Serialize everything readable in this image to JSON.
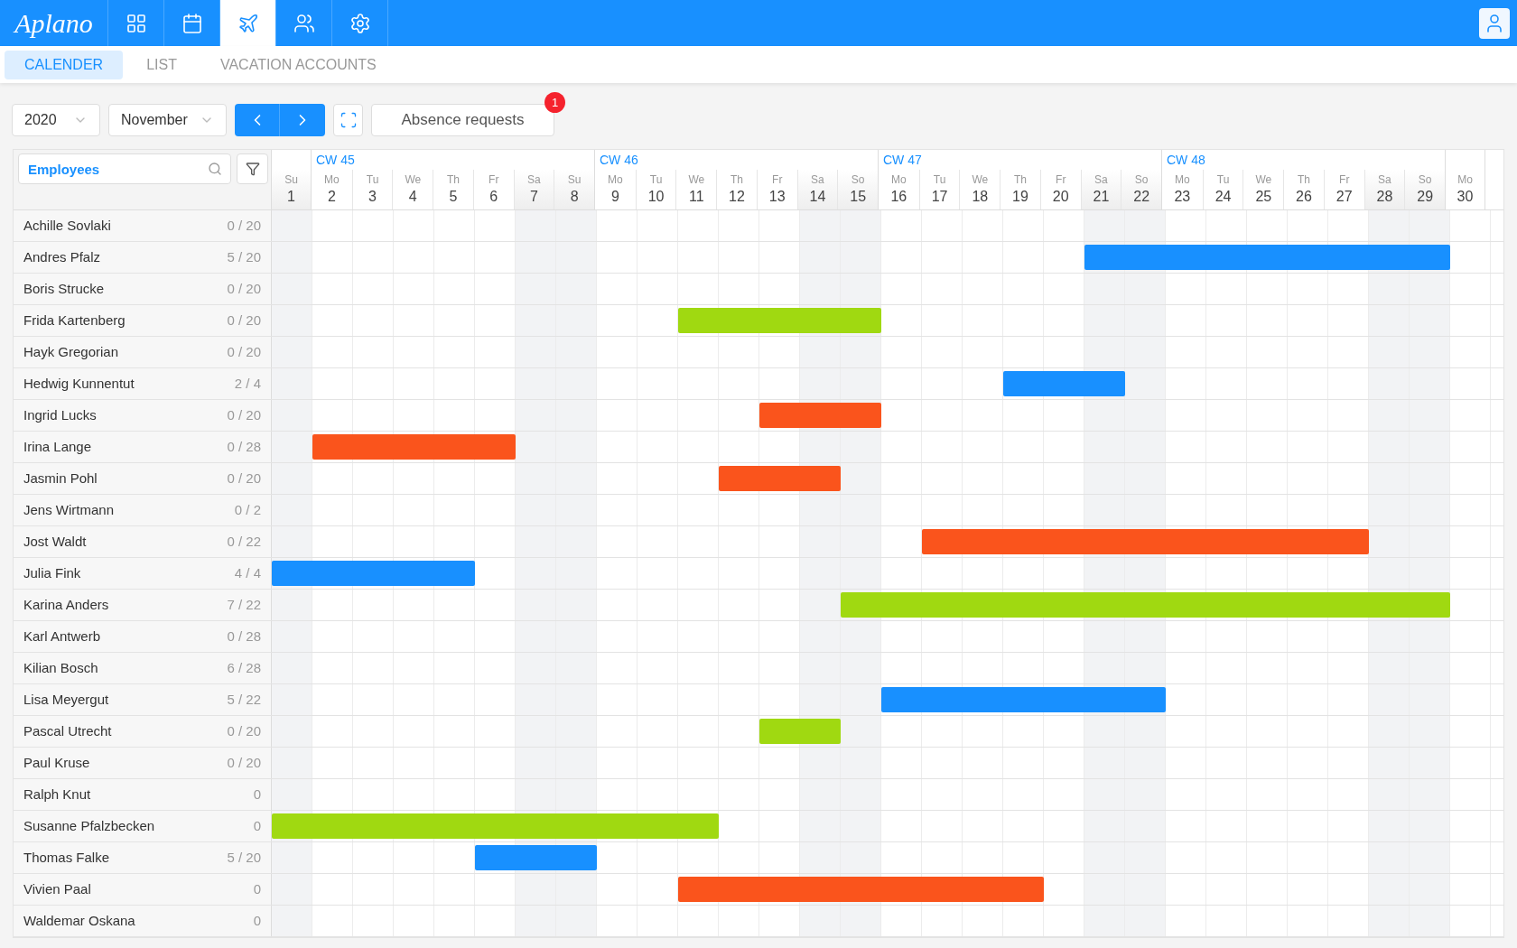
{
  "app": {
    "logo": "Aplano"
  },
  "nav": [
    {
      "kind": "dashboard",
      "selected": false
    },
    {
      "kind": "calendar",
      "selected": false
    },
    {
      "kind": "plane",
      "selected": true
    },
    {
      "kind": "users",
      "selected": false
    },
    {
      "kind": "settings",
      "selected": false
    }
  ],
  "subtabs": [
    {
      "label": "CALENDER",
      "selected": true
    },
    {
      "label": "LIST",
      "selected": false
    },
    {
      "label": "VACATION ACCOUNTS",
      "selected": false
    }
  ],
  "toolbar": {
    "year": "2020",
    "month": "November",
    "absence_requests": {
      "label": "Absence requests",
      "badge": "1"
    }
  },
  "employee_search": {
    "placeholder": "Employees"
  },
  "weeks": [
    {
      "days": [
        {
          "weekday": "Su",
          "day": "1",
          "weekend": true
        }
      ]
    },
    {
      "label": "CW 45",
      "days": [
        {
          "weekday": "Mo",
          "day": "2",
          "weekend": false
        },
        {
          "weekday": "Tu",
          "day": "3",
          "weekend": false
        },
        {
          "weekday": "We",
          "day": "4",
          "weekend": false
        },
        {
          "weekday": "Th",
          "day": "5",
          "weekend": false
        },
        {
          "weekday": "Fr",
          "day": "6",
          "weekend": false
        },
        {
          "weekday": "Sa",
          "day": "7",
          "weekend": true
        },
        {
          "weekday": "Su",
          "day": "8",
          "weekend": true
        }
      ]
    },
    {
      "label": "CW 46",
      "days": [
        {
          "weekday": "Mo",
          "day": "9",
          "weekend": false
        },
        {
          "weekday": "Tu",
          "day": "10",
          "weekend": false
        },
        {
          "weekday": "We",
          "day": "11",
          "weekend": false
        },
        {
          "weekday": "Th",
          "day": "12",
          "weekend": false
        },
        {
          "weekday": "Fr",
          "day": "13",
          "weekend": false
        },
        {
          "weekday": "Sa",
          "day": "14",
          "weekend": true
        },
        {
          "weekday": "So",
          "day": "15",
          "weekend": true
        }
      ]
    },
    {
      "label": "CW 47",
      "days": [
        {
          "weekday": "Mo",
          "day": "16",
          "weekend": false
        },
        {
          "weekday": "Tu",
          "day": "17",
          "weekend": false
        },
        {
          "weekday": "We",
          "day": "18",
          "weekend": false
        },
        {
          "weekday": "Th",
          "day": "19",
          "weekend": false
        },
        {
          "weekday": "Fr",
          "day": "20",
          "weekend": false
        },
        {
          "weekday": "Sa",
          "day": "21",
          "weekend": true
        },
        {
          "weekday": "So",
          "day": "22",
          "weekend": true
        }
      ]
    },
    {
      "label": "CW 48",
      "days": [
        {
          "weekday": "Mo",
          "day": "23",
          "weekend": false
        },
        {
          "weekday": "Tu",
          "day": "24",
          "weekend": false
        },
        {
          "weekday": "We",
          "day": "25",
          "weekend": false
        },
        {
          "weekday": "Th",
          "day": "26",
          "weekend": false
        },
        {
          "weekday": "Fr",
          "day": "27",
          "weekend": false
        },
        {
          "weekday": "Sa",
          "day": "28",
          "weekend": true
        },
        {
          "weekday": "So",
          "day": "29",
          "weekend": true
        }
      ]
    },
    {
      "days": [
        {
          "weekday": "Mo",
          "day": "30",
          "weekend": false
        }
      ]
    }
  ],
  "employees": [
    {
      "name": "Achille Sovlaki",
      "balance": "0 / 20"
    },
    {
      "name": "Andres Pfalz",
      "balance": "5 / 20",
      "color": "#1890ff",
      "absent": [
        false,
        false,
        false,
        false,
        false,
        false,
        false,
        false,
        false,
        false,
        false,
        false,
        false,
        false,
        false,
        false,
        false,
        false,
        false,
        false,
        true,
        true,
        true,
        true,
        true,
        true,
        true,
        true,
        true,
        false
      ]
    },
    {
      "name": "Boris Strucke",
      "balance": "0 / 20"
    },
    {
      "name": "Frida Kartenberg",
      "balance": "0 / 20",
      "color": "#a0d911",
      "absent": [
        false,
        false,
        false,
        false,
        false,
        false,
        false,
        false,
        false,
        false,
        true,
        true,
        true,
        true,
        true,
        false,
        false,
        false,
        false,
        false,
        false,
        false,
        false,
        false,
        false,
        false,
        false,
        false,
        false,
        false
      ]
    },
    {
      "name": "Hayk Gregorian",
      "balance": "0 / 20"
    },
    {
      "name": "Hedwig Kunnentut",
      "balance": "2 / 4",
      "color": "#1890ff",
      "absent": [
        false,
        false,
        false,
        false,
        false,
        false,
        false,
        false,
        false,
        false,
        false,
        false,
        false,
        false,
        false,
        false,
        false,
        false,
        true,
        true,
        true,
        false,
        false,
        false,
        false,
        false,
        false,
        false,
        false,
        false
      ]
    },
    {
      "name": "Ingrid Lucks",
      "balance": "0 / 20",
      "color": "#fa541c",
      "absent": [
        false,
        false,
        false,
        false,
        false,
        false,
        false,
        false,
        false,
        false,
        false,
        false,
        true,
        true,
        true,
        false,
        false,
        false,
        false,
        false,
        false,
        false,
        false,
        false,
        false,
        false,
        false,
        false,
        false,
        false
      ]
    },
    {
      "name": "Irina Lange",
      "balance": "0 / 28",
      "color": "#fa541c",
      "absent": [
        false,
        true,
        true,
        true,
        true,
        true,
        false,
        false,
        false,
        false,
        false,
        false,
        false,
        false,
        false,
        false,
        false,
        false,
        false,
        false,
        false,
        false,
        false,
        false,
        false,
        false,
        false,
        false,
        false,
        false
      ]
    },
    {
      "name": "Jasmin Pohl",
      "balance": "0 / 20",
      "color": "#fa541c",
      "absent": [
        false,
        false,
        false,
        false,
        false,
        false,
        false,
        false,
        false,
        false,
        false,
        true,
        true,
        true,
        false,
        false,
        false,
        false,
        false,
        false,
        false,
        false,
        false,
        false,
        false,
        false,
        false,
        false,
        false,
        false
      ]
    },
    {
      "name": "Jens Wirtmann",
      "balance": "0 / 2"
    },
    {
      "name": "Jost Waldt",
      "balance": "0 / 22",
      "color": "#fa541c",
      "absent": [
        false,
        false,
        false,
        false,
        false,
        false,
        false,
        false,
        false,
        false,
        false,
        false,
        false,
        false,
        false,
        false,
        true,
        true,
        true,
        true,
        true,
        true,
        true,
        true,
        true,
        true,
        true,
        false,
        false,
        false
      ]
    },
    {
      "name": "Julia Fink",
      "balance": "4 / 4",
      "color": "#1890ff",
      "absent": [
        true,
        true,
        true,
        true,
        true,
        false,
        false,
        false,
        false,
        false,
        false,
        false,
        false,
        false,
        false,
        false,
        false,
        false,
        false,
        false,
        false,
        false,
        false,
        false,
        false,
        false,
        false,
        false,
        false,
        false
      ]
    },
    {
      "name": "Karina Anders",
      "balance": "7 / 22",
      "color": "#a0d911",
      "absent": [
        false,
        false,
        false,
        false,
        false,
        false,
        false,
        false,
        false,
        false,
        false,
        false,
        false,
        false,
        true,
        true,
        true,
        true,
        true,
        true,
        true,
        true,
        true,
        true,
        true,
        true,
        true,
        true,
        true,
        false
      ]
    },
    {
      "name": "Karl Antwerb",
      "balance": "0 / 28"
    },
    {
      "name": "Kilian Bosch",
      "balance": "6 / 28"
    },
    {
      "name": "Lisa Meyergut",
      "balance": "5 / 22",
      "color": "#1890ff",
      "absent": [
        false,
        false,
        false,
        false,
        false,
        false,
        false,
        false,
        false,
        false,
        false,
        false,
        false,
        false,
        false,
        true,
        true,
        true,
        true,
        true,
        true,
        true,
        false,
        false,
        false,
        false,
        false,
        false,
        false,
        false
      ]
    },
    {
      "name": "Pascal Utrecht",
      "balance": "0 / 20",
      "color": "#a0d911",
      "absent": [
        false,
        false,
        false,
        false,
        false,
        false,
        false,
        false,
        false,
        false,
        false,
        false,
        true,
        true,
        false,
        false,
        false,
        false,
        false,
        false,
        false,
        false,
        false,
        false,
        false,
        false,
        false,
        false,
        false,
        false
      ]
    },
    {
      "name": "Paul Kruse",
      "balance": "0 / 20"
    },
    {
      "name": "Ralph Knut",
      "balance": "0"
    },
    {
      "name": "Susanne Pfalzbecken",
      "balance": "0",
      "color": "#a0d911",
      "absent": [
        true,
        true,
        true,
        true,
        true,
        true,
        true,
        true,
        true,
        true,
        true,
        false,
        false,
        false,
        false,
        false,
        false,
        false,
        false,
        false,
        false,
        false,
        false,
        false,
        false,
        false,
        false,
        false,
        false,
        false
      ]
    },
    {
      "name": "Thomas Falke",
      "balance": "5 / 20",
      "color": "#1890ff",
      "absent": [
        false,
        false,
        false,
        false,
        false,
        true,
        true,
        true,
        false,
        false,
        false,
        false,
        false,
        false,
        false,
        false,
        false,
        false,
        false,
        false,
        false,
        false,
        false,
        false,
        false,
        false,
        false,
        false,
        false,
        false
      ]
    },
    {
      "name": "Vivien Paal",
      "balance": "0",
      "color": "#fa541c",
      "absent": [
        false,
        false,
        false,
        false,
        false,
        false,
        false,
        false,
        false,
        false,
        true,
        true,
        true,
        true,
        true,
        true,
        true,
        true,
        true,
        false,
        false,
        false,
        false,
        false,
        false,
        false,
        false,
        false,
        false,
        false
      ]
    },
    {
      "name": "Waldemar Oskana",
      "balance": "0"
    }
  ]
}
